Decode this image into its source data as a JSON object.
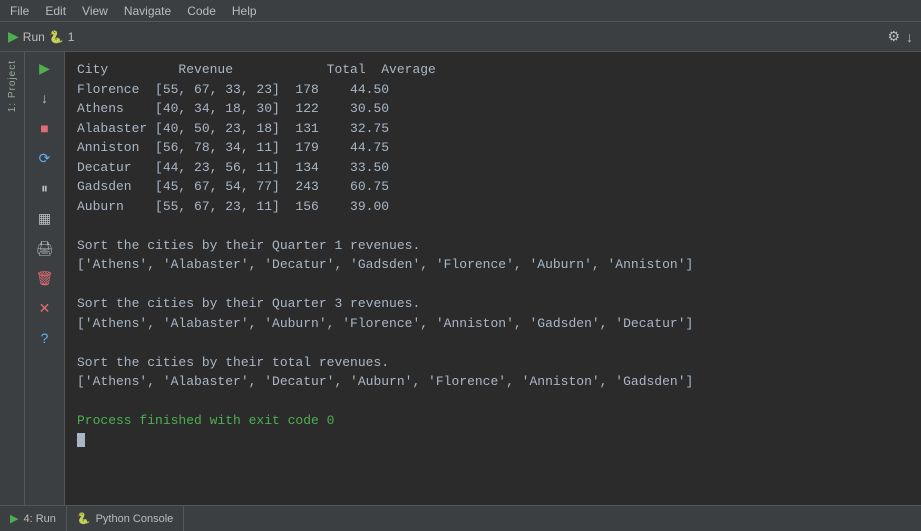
{
  "menubar": {
    "items": [
      "File",
      "Edit",
      "View",
      "Navigate",
      "Code",
      "Help"
    ]
  },
  "toolbar": {
    "run_label": "Run",
    "run_number": "1",
    "gear_icon": "⚙",
    "settings_icon": "↓"
  },
  "sidebar": {
    "label": "1: Project"
  },
  "run_controls": {
    "play": "▶",
    "down": "↓",
    "stop": "■",
    "refresh": "⟳",
    "pause": "⏸",
    "grid": "▦",
    "print": "🖨",
    "trash": "🗑",
    "cross": "✕",
    "question": "?"
  },
  "console": {
    "header_line": "City         Revenue            Total  Average",
    "rows": [
      {
        "city": "Florence",
        "revenue": "[55, 67, 33, 23]",
        "total": "178",
        "avg": "44.50"
      },
      {
        "city": "Athens",
        "revenue": "[40, 34, 18, 30]",
        "total": "122",
        "avg": "30.50"
      },
      {
        "city": "Alabaster",
        "revenue": "[40, 50, 23, 18]",
        "total": "131",
        "avg": "32.75"
      },
      {
        "city": "Anniston",
        "revenue": "[56, 78, 34, 11]",
        "total": "179",
        "avg": "44.75"
      },
      {
        "city": "Decatur",
        "revenue": "[44, 23, 56, 11]",
        "total": "134",
        "avg": "33.50"
      },
      {
        "city": "Gadsden",
        "revenue": "[45, 67, 54, 77]",
        "total": "243",
        "avg": "60.75"
      },
      {
        "city": "Auburn",
        "revenue": "[55, 67, 23, 11]",
        "total": "156",
        "avg": "39.00"
      }
    ],
    "sort_q1_label": "Sort the cities by their Quarter 1 revenues.",
    "sort_q1_result": "['Athens', 'Alabaster', 'Decatur', 'Gadsden', 'Florence', 'Auburn', 'Anniston']",
    "sort_q3_label": "Sort the cities by their Quarter 3 revenues.",
    "sort_q3_result": "['Athens', 'Alabaster', 'Auburn', 'Florence', 'Anniston', 'Gadsden', 'Decatur']",
    "sort_total_label": "Sort the cities by their total revenues.",
    "sort_total_result": "['Athens', 'Alabaster', 'Decatur', 'Auburn', 'Florence', 'Anniston', 'Gadsden']",
    "process_msg": "Process finished with exit code 0"
  },
  "bottombar": {
    "tab1_icon": "▶",
    "tab1_label": "4: Run",
    "tab2_icon": "🐍",
    "tab2_label": "Python Console"
  }
}
